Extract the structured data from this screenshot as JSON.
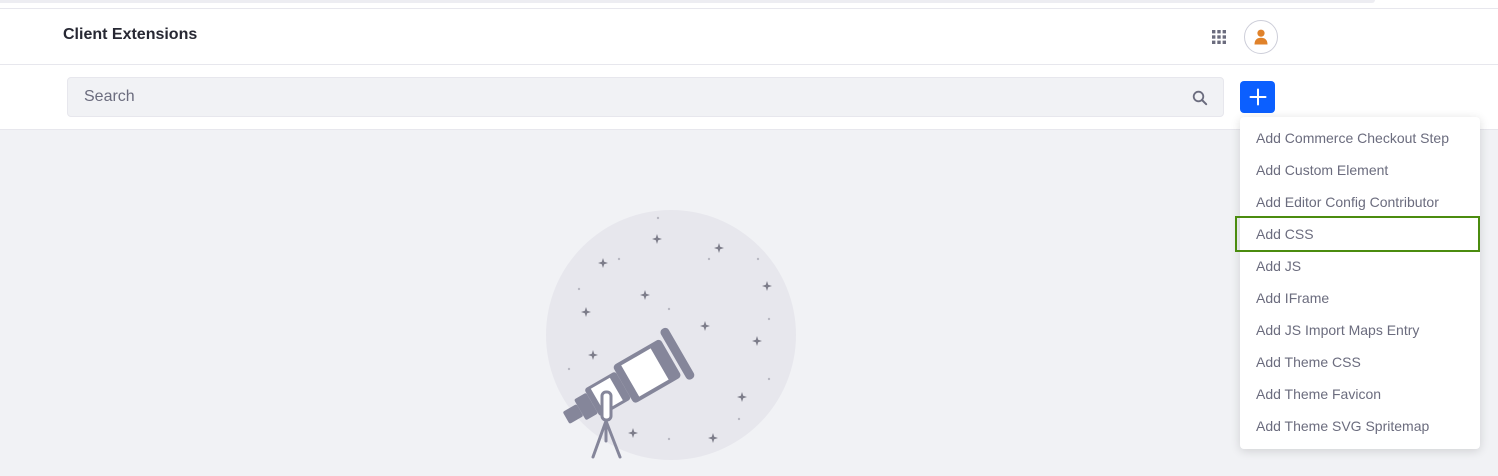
{
  "header": {
    "title": "Client Extensions",
    "apps_icon": "apps-grid-icon",
    "user_icon": "user-icon",
    "accent_color": "#e0822a"
  },
  "toolbar": {
    "search": {
      "placeholder": "Search",
      "value": ""
    },
    "search_icon": "search-icon",
    "add_icon": "plus-icon",
    "add_button_color": "#0b5fff"
  },
  "dropdown": {
    "items": [
      {
        "label": "Add Commerce Checkout Step"
      },
      {
        "label": "Add Custom Element"
      },
      {
        "label": "Add Editor Config Contributor"
      },
      {
        "label": "Add CSS",
        "focused": true
      },
      {
        "label": "Add JS"
      },
      {
        "label": "Add IFrame"
      },
      {
        "label": "Add JS Import Maps Entry"
      },
      {
        "label": "Add Theme CSS"
      },
      {
        "label": "Add Theme Favicon"
      },
      {
        "label": "Add Theme SVG Spritemap"
      }
    ]
  },
  "empty_state": {
    "illustration": "telescope-icon"
  }
}
